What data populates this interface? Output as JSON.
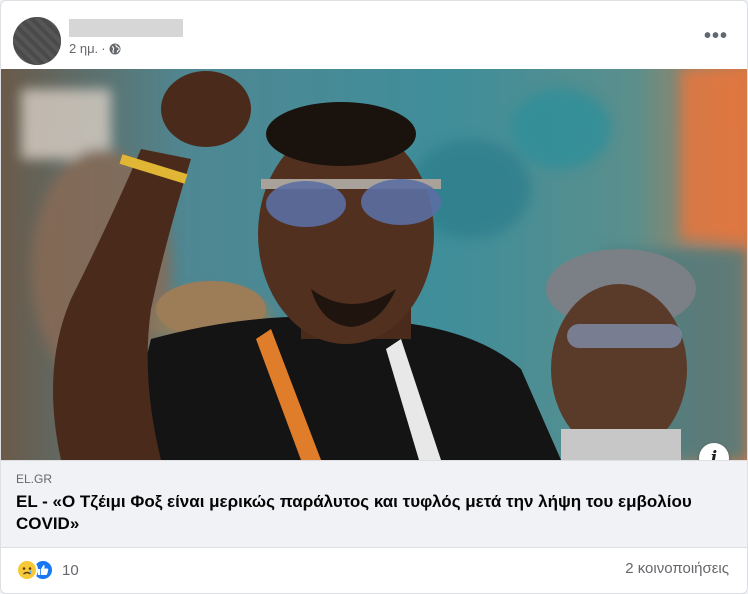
{
  "post": {
    "time": "2 ημ.",
    "separator": "·",
    "privacy_icon": "globe-icon",
    "more_icon": "more-options-icon",
    "more_label": "•••"
  },
  "image": {
    "info_label": "i"
  },
  "link": {
    "domain": "EL.GR",
    "headline": "EL - «Ο Τζέιμι Φοξ είναι μερικώς παράλυτος και τυφλός μετά την λήψη του εμβολίου COVID»"
  },
  "footer": {
    "reaction_icons": [
      "sad-reaction-icon",
      "like-reaction-icon"
    ],
    "reaction_count": "10",
    "shares": "2 κοινοποιήσεις"
  }
}
